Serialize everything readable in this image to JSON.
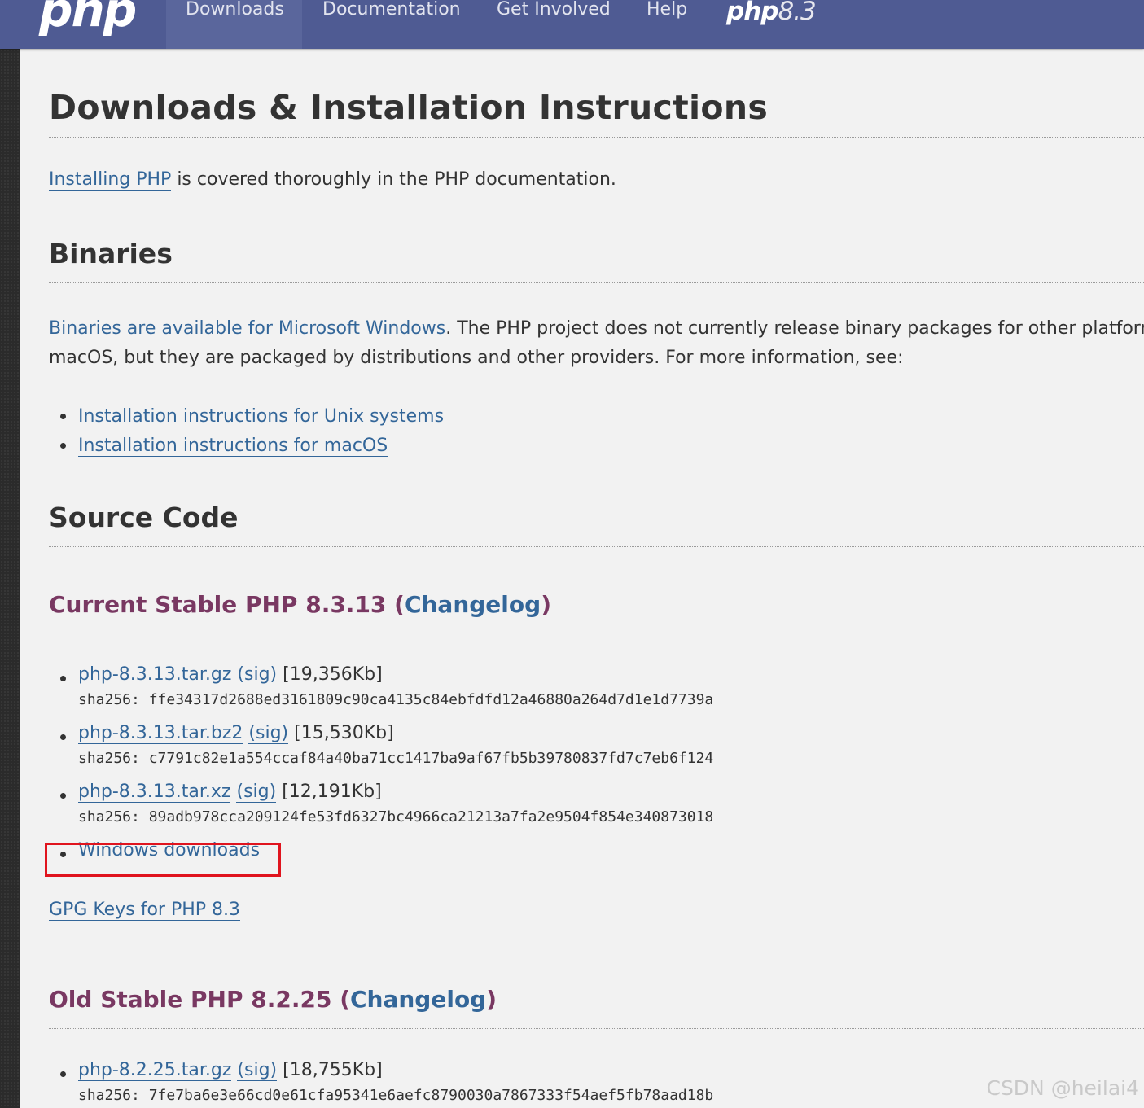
{
  "nav": {
    "logo": "php",
    "items": [
      "Downloads",
      "Documentation",
      "Get Involved",
      "Help"
    ],
    "version_badge_php": "php",
    "version_badge_num": "8.3"
  },
  "page": {
    "title": "Downloads & Installation Instructions",
    "intro_link": "Installing PHP",
    "intro_rest": " is covered thoroughly in the PHP documentation.",
    "binaries_heading": "Binaries",
    "binaries_link": "Binaries are available for Microsoft Windows",
    "binaries_rest_1": ". The PHP project does not currently release binary packages for other platform",
    "binaries_rest_2": "macOS, but they are packaged by distributions and other providers. For more information, see:",
    "binaries_links": [
      "Installation instructions for Unix systems",
      "Installation instructions for macOS"
    ],
    "source_heading": "Source Code"
  },
  "current": {
    "heading": "Current Stable PHP 8.3.13 (",
    "changelog": "Changelog",
    "close": ")",
    "files": [
      {
        "name": "php-8.3.13.tar.gz",
        "sig": "(sig)",
        "size": " [19,356Kb]",
        "sha": "sha256: ffe34317d2688ed3161809c90ca4135c84ebfdfd12a46880a264d7d1e1d7739a"
      },
      {
        "name": "php-8.3.13.tar.bz2",
        "sig": "(sig)",
        "size": " [15,530Kb]",
        "sha": "sha256: c7791c82e1a554ccaf84a40ba71cc1417ba9af67fb5b39780837fd7c7eb6f124"
      },
      {
        "name": "php-8.3.13.tar.xz",
        "sig": "(sig)",
        "size": " [12,191Kb]",
        "sha": "sha256: 89adb978cca209124fe53fd6327bc4966ca21213a7fa2e9504f854e340873018"
      }
    ],
    "windows": "Windows downloads",
    "gpg": "GPG Keys for PHP 8.3"
  },
  "old": {
    "heading": "Old Stable PHP 8.2.25 (",
    "changelog": "Changelog",
    "close": ")",
    "file": {
      "name": "php-8.2.25.tar.gz",
      "sig": "(sig)",
      "size": " [18,755Kb]",
      "sha": "sha256: 7fe7ba6e3e66cd0e61cfa95341e6aefc8790030a7867333f54aef5fb78aad18b"
    }
  },
  "watermark": "CSDN @heilai4"
}
